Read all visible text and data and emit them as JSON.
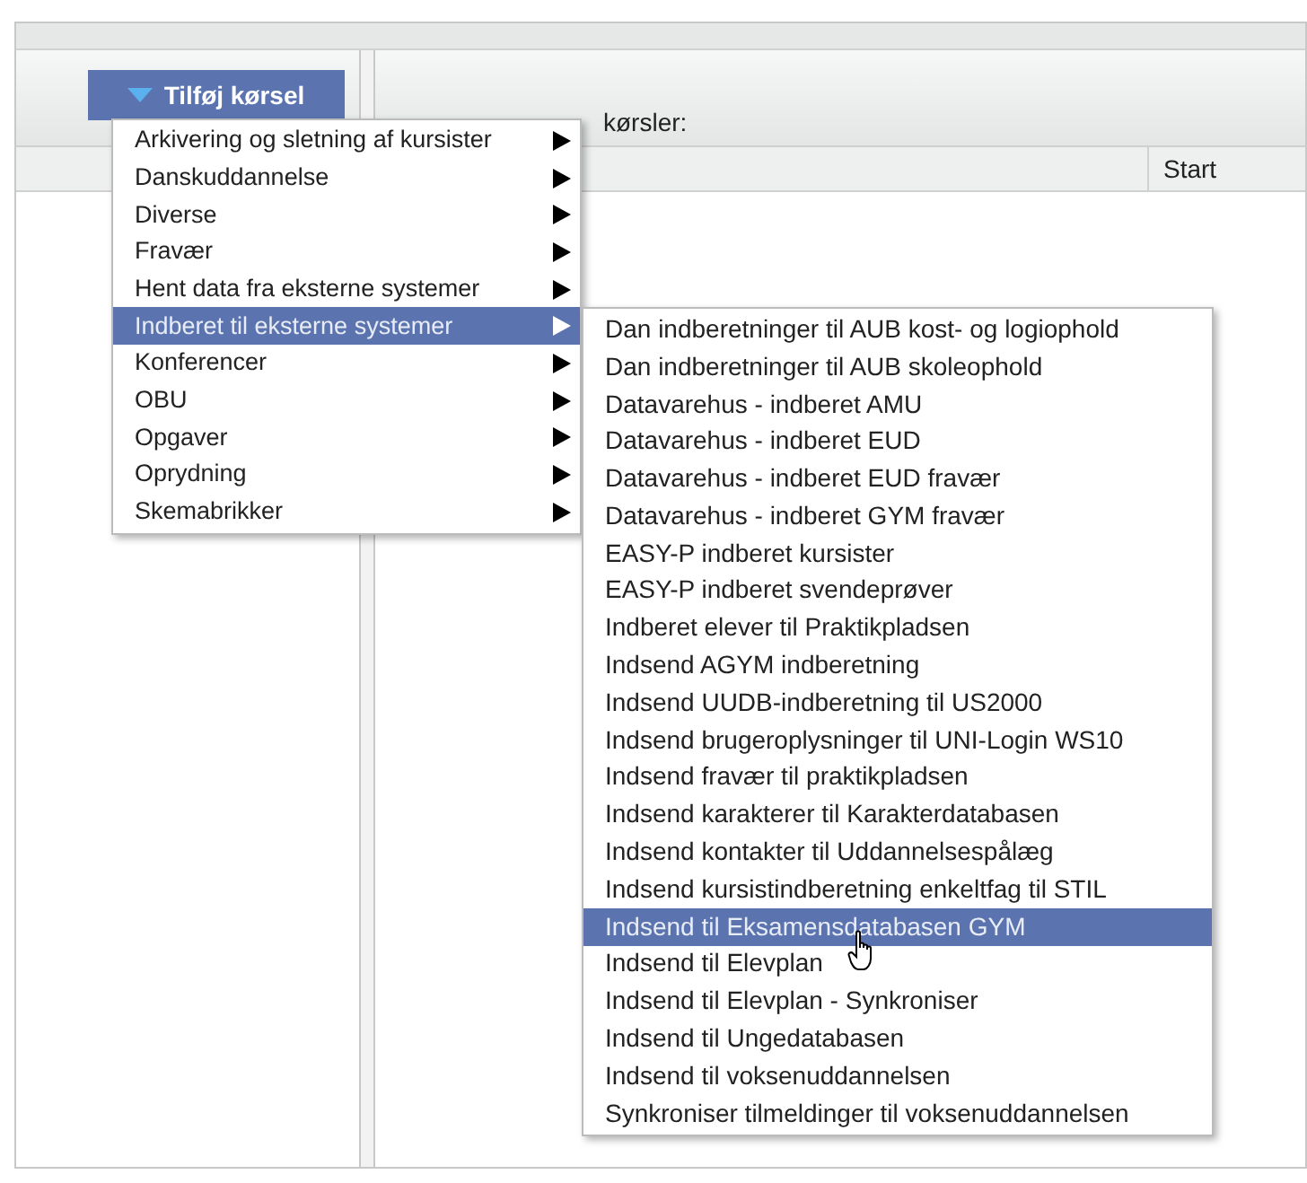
{
  "toolbar": {
    "add_button": {
      "label": "Tilføj kørsel"
    }
  },
  "right_panel": {
    "label": "kørsler:",
    "columns": [
      {
        "label": "Start"
      }
    ]
  },
  "menu": {
    "items": [
      {
        "label": "Arkivering og sletning af kursister",
        "has_submenu": true,
        "selected": false
      },
      {
        "label": "Danskuddannelse",
        "has_submenu": true,
        "selected": false
      },
      {
        "label": "Diverse",
        "has_submenu": true,
        "selected": false
      },
      {
        "label": "Fravær",
        "has_submenu": true,
        "selected": false
      },
      {
        "label": "Hent data fra eksterne systemer",
        "has_submenu": true,
        "selected": false
      },
      {
        "label": "Indberet til eksterne systemer",
        "has_submenu": true,
        "selected": true
      },
      {
        "label": "Konferencer",
        "has_submenu": true,
        "selected": false
      },
      {
        "label": "OBU",
        "has_submenu": true,
        "selected": false
      },
      {
        "label": "Opgaver",
        "has_submenu": true,
        "selected": false
      },
      {
        "label": "Oprydning",
        "has_submenu": true,
        "selected": false
      },
      {
        "label": "Skemabrikker",
        "has_submenu": true,
        "selected": false
      }
    ]
  },
  "submenu": {
    "items": [
      {
        "label": "Dan indberetninger til AUB kost- og logiophold",
        "selected": false
      },
      {
        "label": "Dan indberetninger til AUB skoleophold",
        "selected": false
      },
      {
        "label": "Datavarehus - indberet AMU",
        "selected": false
      },
      {
        "label": "Datavarehus - indberet EUD",
        "selected": false
      },
      {
        "label": "Datavarehus - indberet EUD fravær",
        "selected": false
      },
      {
        "label": "Datavarehus - indberet GYM fravær",
        "selected": false
      },
      {
        "label": "EASY-P indberet kursister",
        "selected": false
      },
      {
        "label": "EASY-P indberet svendeprøver",
        "selected": false
      },
      {
        "label": "Indberet elever til Praktikpladsen",
        "selected": false
      },
      {
        "label": "Indsend AGYM indberetning",
        "selected": false
      },
      {
        "label": "Indsend UUDB-indberetning til US2000",
        "selected": false
      },
      {
        "label": "Indsend brugeroplysninger til UNI-Login WS10",
        "selected": false
      },
      {
        "label": "Indsend fravær til praktikpladsen",
        "selected": false
      },
      {
        "label": "Indsend karakterer til Karakterdatabasen",
        "selected": false
      },
      {
        "label": "Indsend kontakter til Uddannelsespålæg",
        "selected": false
      },
      {
        "label": "Indsend kursistindberetning enkeltfag til STIL",
        "selected": false
      },
      {
        "label": "Indsend til Eksamensdatabasen GYM",
        "selected": true
      },
      {
        "label": "Indsend til Elevplan",
        "selected": false
      },
      {
        "label": "Indsend til Elevplan - Synkroniser",
        "selected": false
      },
      {
        "label": "Indsend til Ungedatabasen",
        "selected": false
      },
      {
        "label": "Indsend til voksenuddannelsen",
        "selected": false
      },
      {
        "label": "Synkroniser tilmeldinger til voksenuddannelsen",
        "selected": false
      }
    ]
  }
}
